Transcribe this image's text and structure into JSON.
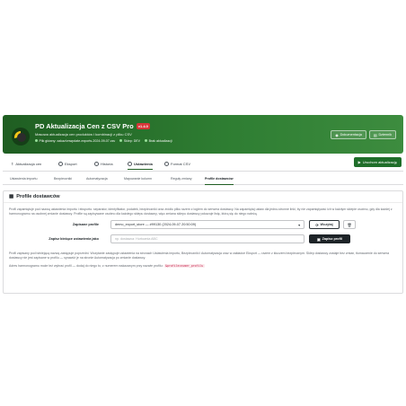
{
  "header": {
    "title": "PD Aktualizacja Cen z CSV Pro",
    "version": "v1.4.0",
    "subtitle": "Masowa aktualizacja cen produktów i kombinacji z pliku CSV",
    "meta": [
      "Plik główny: zakaz/vnwpdate-exports-2024-09-07.csv",
      "Sklep: DEV",
      "Brak aktualizacji"
    ],
    "buttons": [
      "Dokumentacja",
      "Dziennik"
    ]
  },
  "main_tabs": [
    {
      "label": "Aktualizacja cen",
      "icon": "upload-icon"
    },
    {
      "label": "Eksport",
      "icon": "export-icon"
    },
    {
      "label": "Historia",
      "icon": "history-icon"
    },
    {
      "label": "Ustawienia",
      "icon": "settings-icon",
      "active": true
    },
    {
      "label": "Format CSV",
      "icon": "help-icon"
    }
  ],
  "run_button": "Uruchom aktualizację",
  "sub_tabs": [
    {
      "label": "Ustawienia importu"
    },
    {
      "label": "Bezpieczniki"
    },
    {
      "label": "Automatyzacja"
    },
    {
      "label": "Mapowanie kolumn"
    },
    {
      "label": "Reguły zmiany"
    },
    {
      "label": "Profile dostawców",
      "active": true
    }
  ],
  "panel": {
    "title": "Profile dostawców",
    "intro": "Profil zapamiętuje pod nazwą ustawienia importu i eksportu: separator, identyfikator, podatek, bezpieczniki oraz źródło pliku razem z logiem do serwera dostawcy. Na zapamiętaj ustaw dla jedno-stronne linki, by nie zapamiętywać ich w każdym sklepie osobno, gdy dla każdej z harmonogramu na osobnej zmianie dostawcy. Profile są zapisywane osobno dla każdego sklepu dostawcy, więc zmiana sklepu dostawcy pokazuje listę, którą się do niego należą.",
    "saved_label": "Zapisane profile",
    "saved_value": "demo_export_store — #99130 (2024-09-07 20:50:09)",
    "load_button": "Wczytaj",
    "save_as_label": "Zapisz bieżące ustawienia jako",
    "save_as_placeholder": "np. dostawca: Hurtownia ABC",
    "save_button": "Zapisz profil",
    "note1": "Profil zapisany pod istniejącą nazwą zastępuje poprzedni. Wczytanie zastępuje ustawienia na stronach Ustawienia importu, Bezpieczniki i Automatyzacja oraz w zakładce Eksport — razem z kluczem bezpiecznym. Sklep dostawcy zostaje bez zmian, tłumaczenie do serwera dostawcy nie jest zapisane w profilu — sprawdź je na stronie Automatyzacja po zmianie dostawcy.",
    "note2_pre": "Adres harmonogramu może też wybrać profil — dodaj do niego to, z numerem wskazanym przy nazwie profilu:",
    "note2_code": "&profile=numer_profilu"
  }
}
